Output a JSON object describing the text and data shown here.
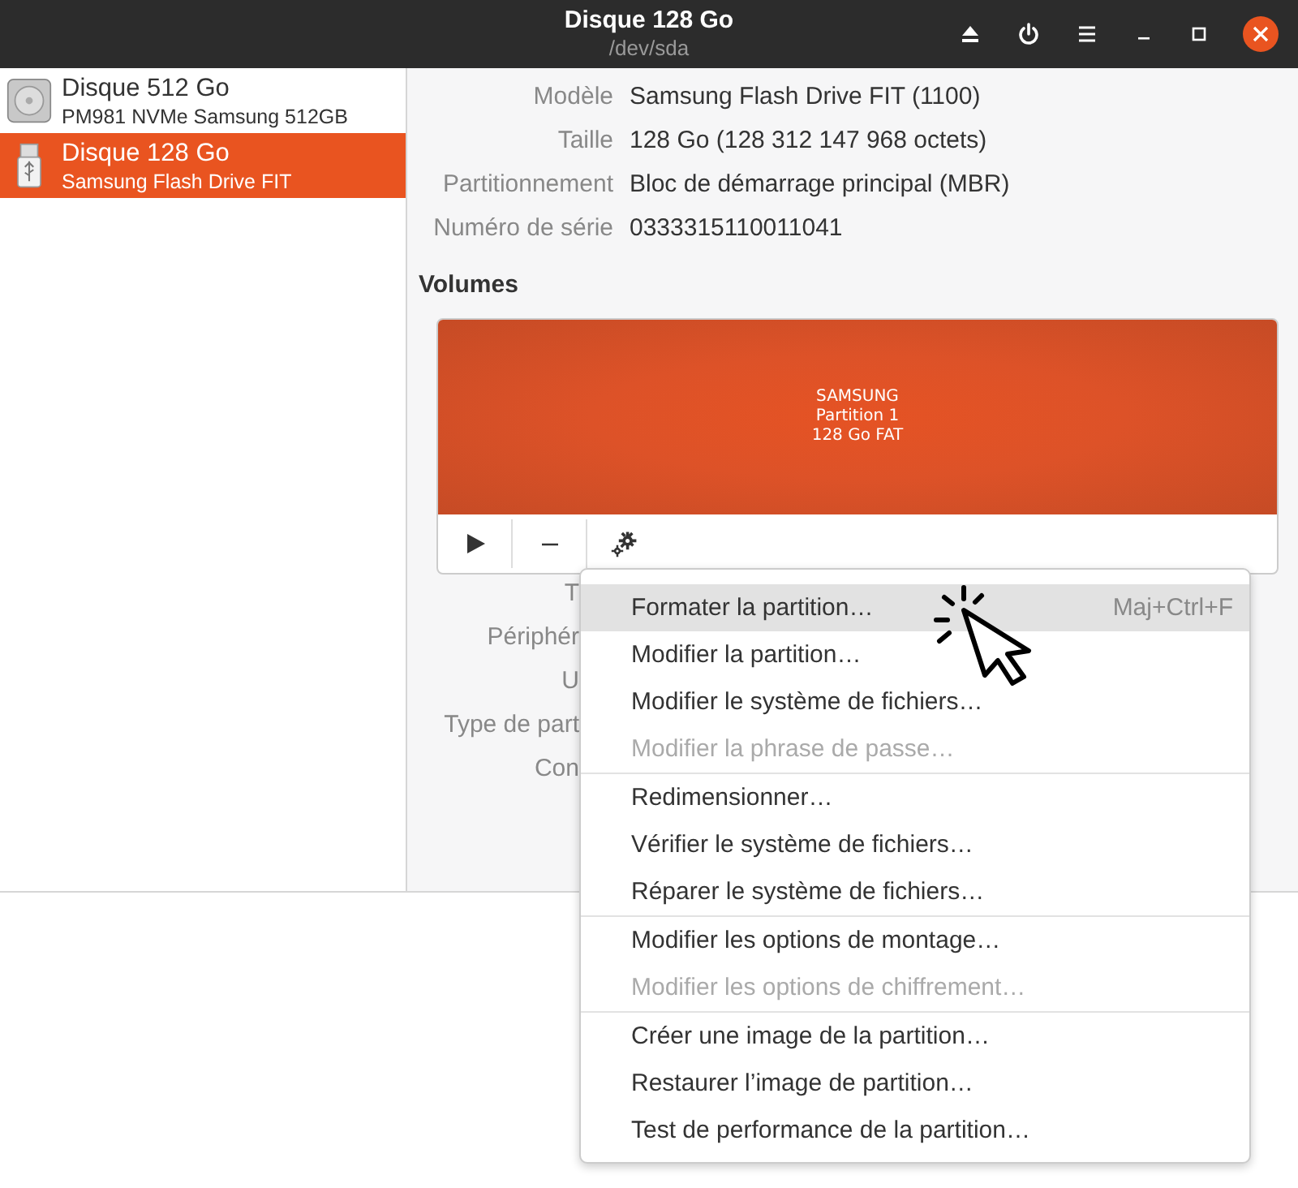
{
  "window": {
    "title": "Disque 128 Go",
    "subtitle": "/dev/sda"
  },
  "disks": [
    {
      "name": "Disque 512 Go",
      "description": "PM981 NVMe Samsung 512GB",
      "kind": "hdd",
      "selected": false
    },
    {
      "name": "Disque 128 Go",
      "description": "Samsung Flash Drive FIT",
      "kind": "usb",
      "selected": true
    }
  ],
  "drive_info": [
    {
      "label": "Modèle",
      "value": "Samsung Flash Drive FIT (1100)"
    },
    {
      "label": "Taille",
      "value": "128 Go (128 312 147 968 octets)"
    },
    {
      "label": "Partitionnement",
      "value": "Bloc de démarrage principal (MBR)"
    },
    {
      "label": "Numéro de série",
      "value": "0333315110011041"
    }
  ],
  "volumes": {
    "title": "Volumes",
    "partition": {
      "lines": [
        "SAMSUNG",
        "Partition 1",
        "128 Go FAT"
      ]
    },
    "info_labels": [
      "T",
      "Périphér",
      "U",
      "Type de part",
      "Con"
    ]
  },
  "context_menu": {
    "sections": [
      [
        {
          "label": "Formater la partition…",
          "shortcut": "Maj+Ctrl+F",
          "disabled": false,
          "selected": true
        },
        {
          "label": "Modifier la partition…",
          "disabled": false,
          "selected": false
        },
        {
          "label": "Modifier le système de fichiers…",
          "disabled": false,
          "selected": false
        },
        {
          "label": "Modifier la phrase de passe…",
          "disabled": true,
          "selected": false
        }
      ],
      [
        {
          "label": "Redimensionner…",
          "disabled": false,
          "selected": false
        },
        {
          "label": "Vérifier le système de fichiers…",
          "disabled": false,
          "selected": false
        },
        {
          "label": "Réparer le système de fichiers…",
          "disabled": false,
          "selected": false
        }
      ],
      [
        {
          "label": "Modifier les options de montage…",
          "disabled": false,
          "selected": false
        },
        {
          "label": "Modifier les options de chiffrement…",
          "disabled": true,
          "selected": false
        }
      ],
      [
        {
          "label": "Créer une image de la partition…",
          "disabled": false,
          "selected": false
        },
        {
          "label": "Restaurer l’image de partition…",
          "disabled": false,
          "selected": false
        },
        {
          "label": "Test de performance de la partition…",
          "disabled": false,
          "selected": false
        }
      ]
    ]
  }
}
